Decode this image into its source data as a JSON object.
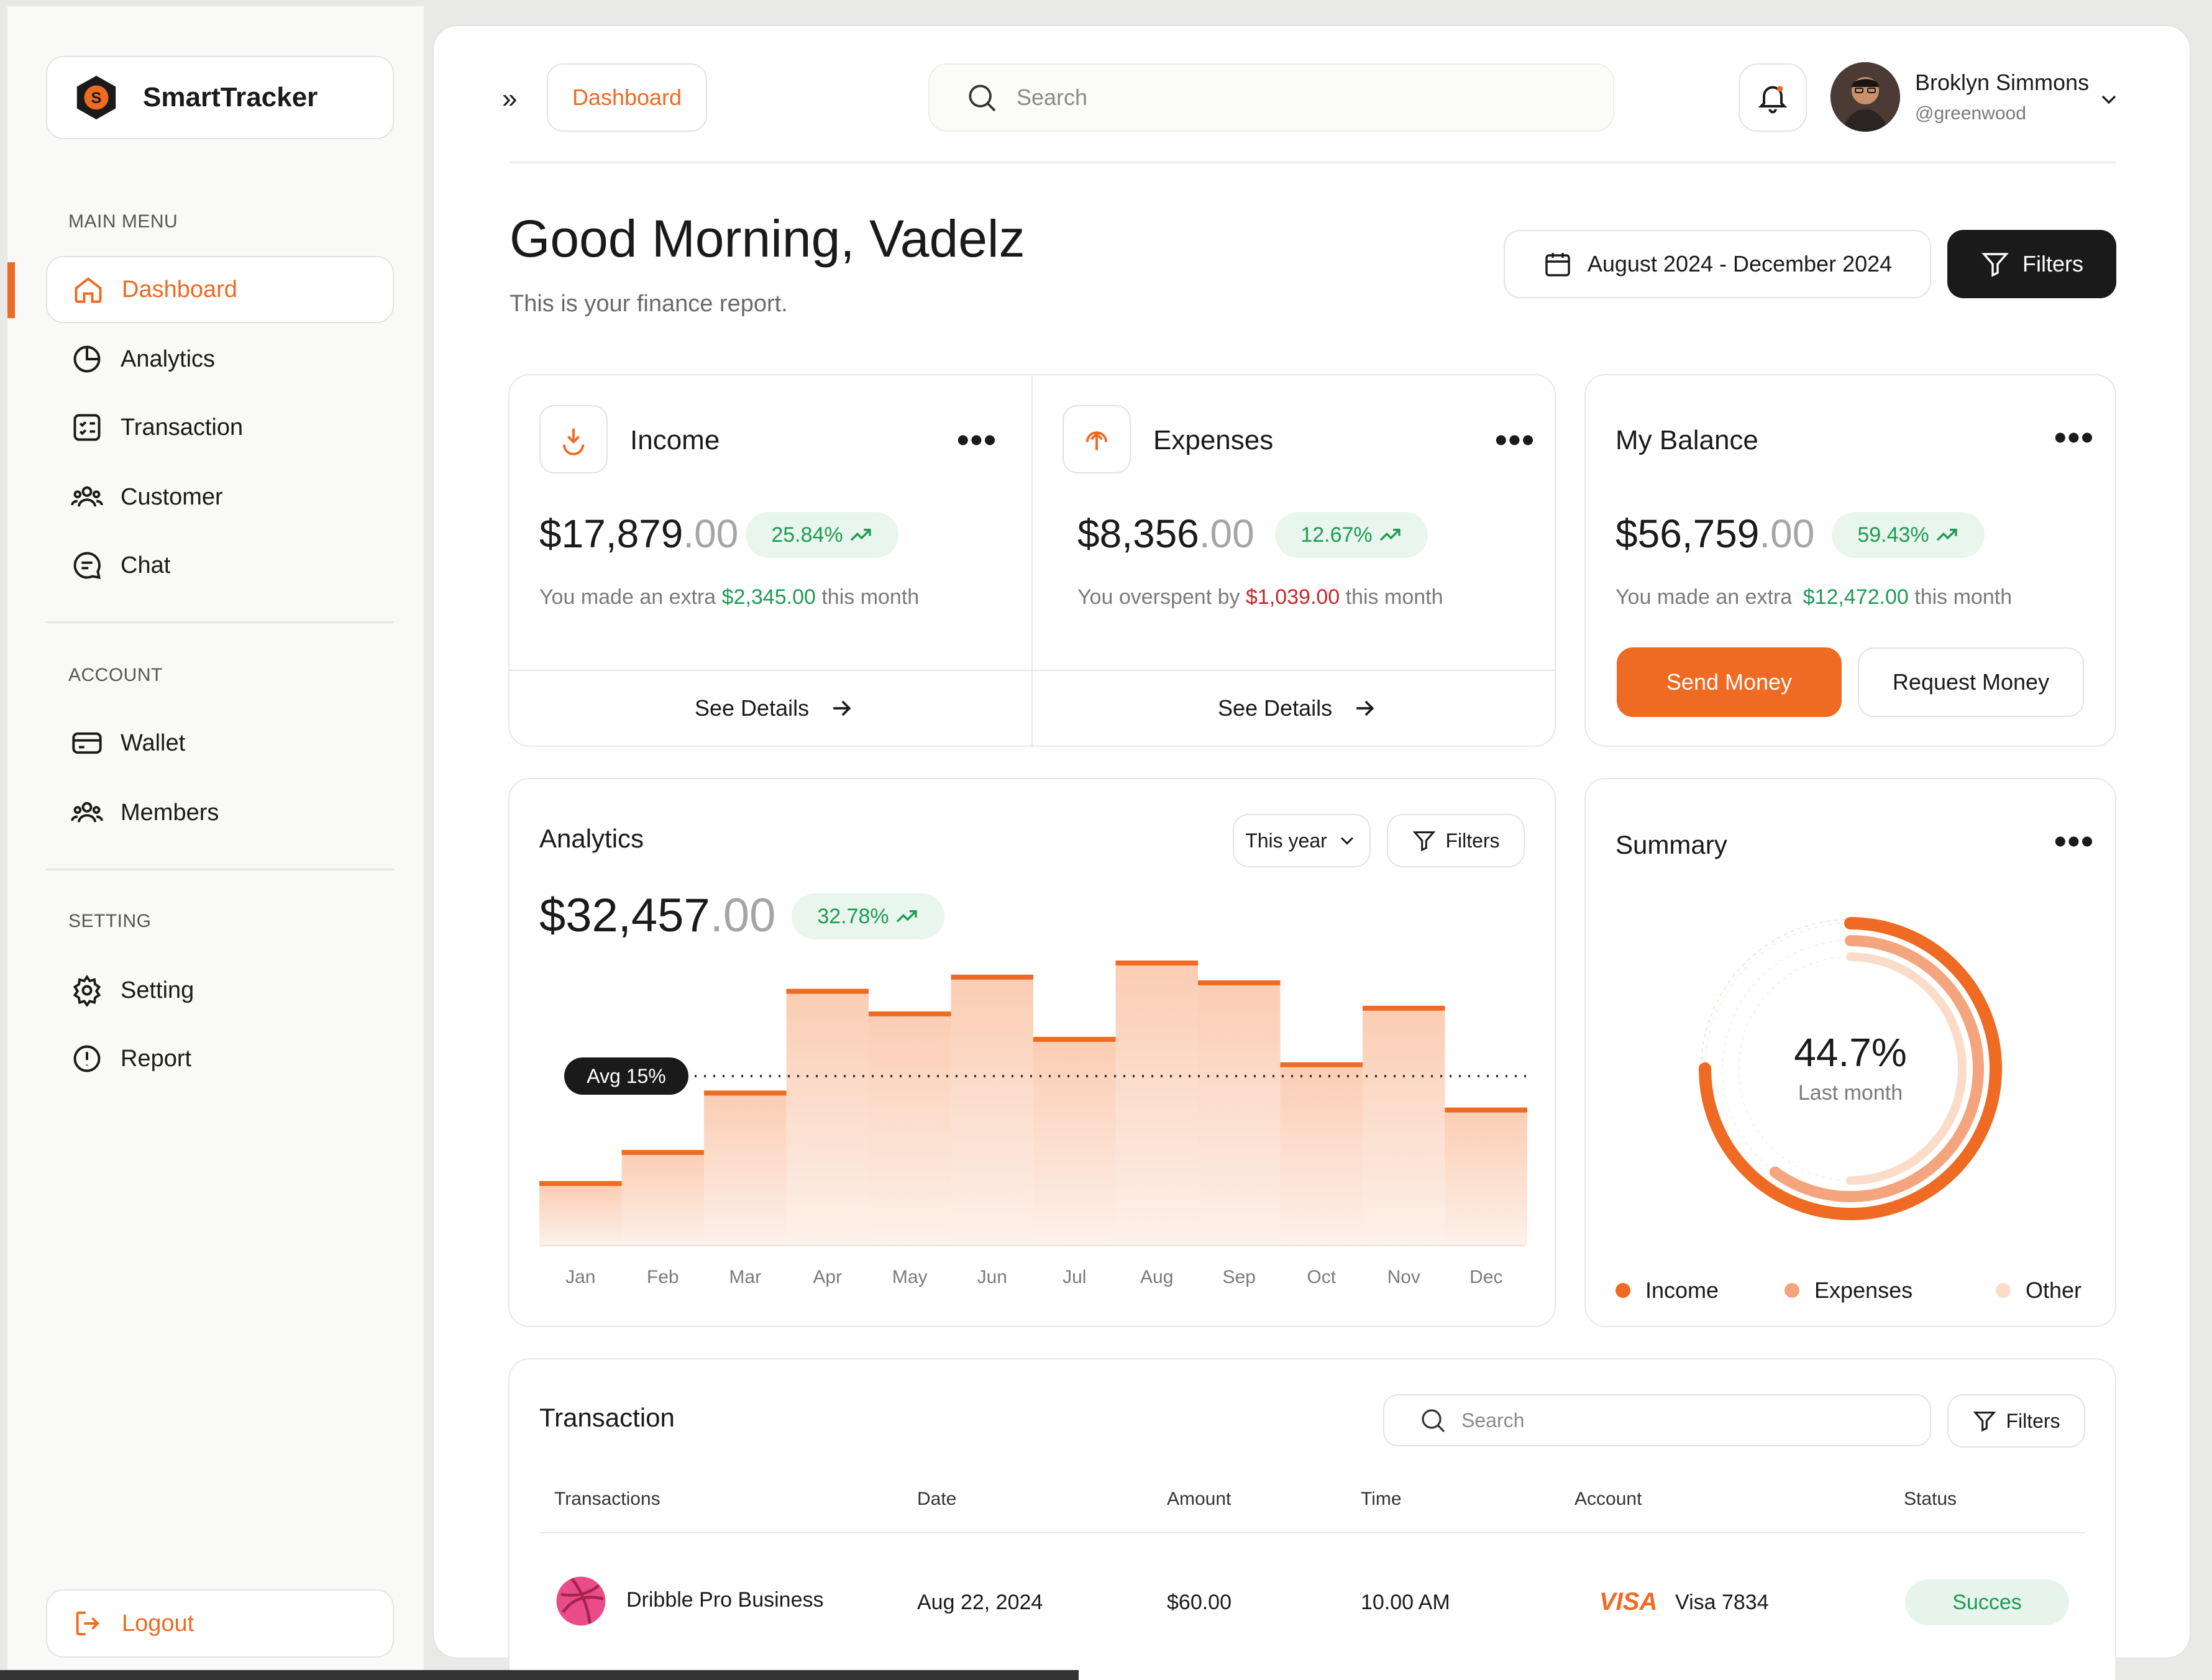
{
  "app": {
    "name": "SmartTracker"
  },
  "sidebar": {
    "sections": [
      {
        "label": "MAIN MENU"
      },
      {
        "label": "ACCOUNT"
      },
      {
        "label": "SETTING"
      }
    ],
    "items": [
      {
        "label": "Dashboard",
        "icon": "home-icon",
        "active": true
      },
      {
        "label": "Analytics",
        "icon": "pie-chart-icon"
      },
      {
        "label": "Transaction",
        "icon": "checklist-icon"
      },
      {
        "label": "Customer",
        "icon": "users-icon"
      },
      {
        "label": "Chat",
        "icon": "chat-icon"
      },
      {
        "label": "Wallet",
        "icon": "wallet-icon"
      },
      {
        "label": "Members",
        "icon": "users-icon"
      },
      {
        "label": "Setting",
        "icon": "gear-icon"
      },
      {
        "label": "Report",
        "icon": "alert-circle-icon"
      }
    ],
    "logout": "Logout"
  },
  "topbar": {
    "breadcrumb": "Dashboard",
    "search_placeholder": "Search",
    "user": {
      "name": "Broklyn Simmons",
      "handle": "@greenwood"
    }
  },
  "header": {
    "greeting": "Good Morning, Vadelz",
    "subtitle": "This is your finance report.",
    "date_range": "August 2024 - December 2024",
    "filters": "Filters"
  },
  "income": {
    "title": "Income",
    "amount_main": "$17,879",
    "amount_cents": ".00",
    "change": "25.84%",
    "note_prefix": "You made an extra",
    "note_value": "$2,345.00",
    "note_suffix": "this month",
    "link": "See Details"
  },
  "expenses": {
    "title": "Expenses",
    "amount_main": "$8,356",
    "amount_cents": ".00",
    "change": "12.67%",
    "note_prefix": "You overspent by",
    "note_value": "$1,039.00",
    "note_suffix": "this month",
    "link": "See Details"
  },
  "balance": {
    "title": "My Balance",
    "amount_main": "$56,759",
    "amount_cents": ".00",
    "change": "59.43%",
    "note_prefix": "You made an extra",
    "note_value": "$12,472.00",
    "note_suffix": "this month",
    "send": "Send Money",
    "request": "Request Money"
  },
  "analytics": {
    "title": "Analytics",
    "period": "This year",
    "filters": "Filters",
    "amount_main": "$32,457",
    "amount_cents": ".00",
    "change": "32.78%",
    "avg_label": "Avg 15%"
  },
  "chart_data": [
    {
      "type": "bar",
      "categories": [
        "Jan",
        "Feb",
        "Mar",
        "Apr",
        "May",
        "Jun",
        "Jul",
        "Aug",
        "Sep",
        "Oct",
        "Nov",
        "Dec"
      ],
      "values": [
        22,
        33,
        54,
        90,
        82,
        95,
        73,
        100,
        93,
        64,
        84,
        48
      ],
      "avg_line": 60,
      "avg_label": "Avg 15%",
      "ylim": [
        0,
        100
      ],
      "grid": false,
      "colors": {
        "bar_top": "#ef6a22",
        "bar_fill": "#fbd2bb"
      }
    },
    {
      "type": "pie",
      "title": "Summary",
      "center_value": "44.7%",
      "center_label": "Last month",
      "series": [
        {
          "name": "Income",
          "value": 75,
          "color": "#ef6a22"
        },
        {
          "name": "Expenses",
          "value": 60,
          "color": "#f4a57d"
        },
        {
          "name": "Other",
          "value": 50,
          "color": "#fbdcc9"
        }
      ]
    }
  ],
  "summary": {
    "title": "Summary",
    "legend": [
      "Income",
      "Expenses",
      "Other"
    ]
  },
  "transactions": {
    "title": "Transaction",
    "search_placeholder": "Search",
    "filters": "Filters",
    "columns": [
      "Transactions",
      "Date",
      "Amount",
      "Time",
      "Account",
      "Status"
    ],
    "rows": [
      {
        "name": "Dribble Pro Business",
        "date": "Aug 22, 2024",
        "amount": "$60.00",
        "time": "10.00 AM",
        "card_brand": "VISA",
        "account": "Visa 7834",
        "status": "Succes"
      }
    ]
  }
}
